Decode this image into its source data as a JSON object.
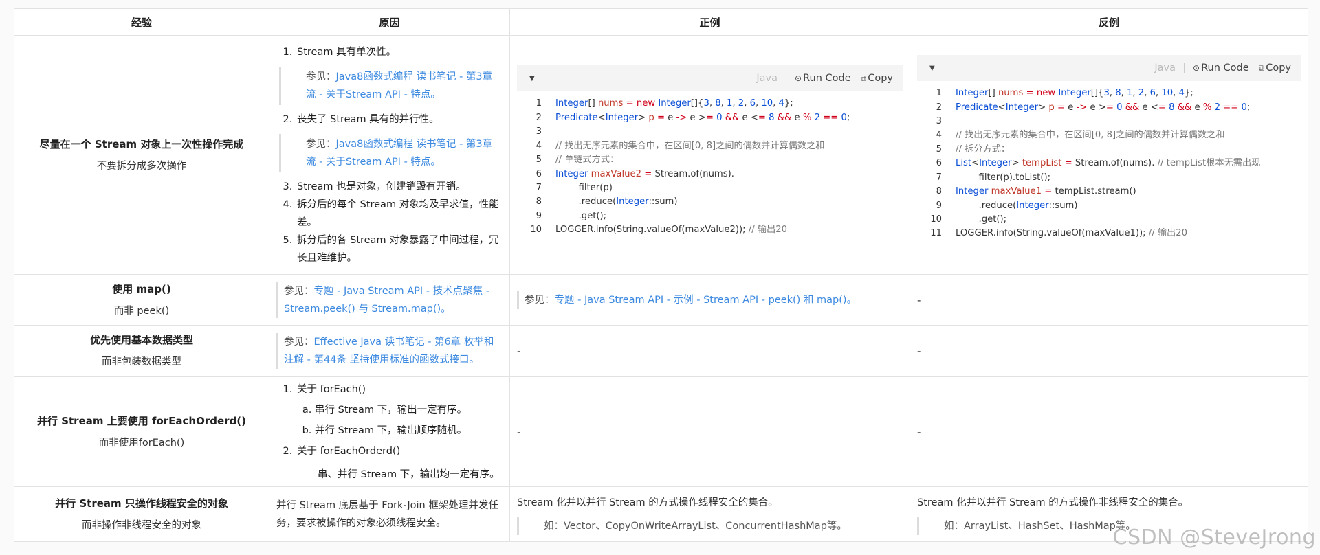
{
  "headers": [
    "经验",
    "原因",
    "正例",
    "反例"
  ],
  "rows": [
    {
      "exp_title": "尽量在一个 Stream 对象上一次性操作完成",
      "exp_sub": "不要拆分成多次操作",
      "reasons": [
        "Stream 具有单次性。",
        "丧失了 Stream 具有的并行性。",
        "Stream 也是对象，创建销毁有开销。",
        "拆分后的每个 Stream 对象均及早求值，性能差。",
        "拆分后的各 Stream 对象暴露了中间过程，冗长且难维护。"
      ],
      "quote_prefix": "参见：",
      "quote_link": "Java8函数式编程 读书笔记 - 第3章 流 - 关于Stream API - 特点。",
      "quote_prefix2": "参见：",
      "quote_link2": "Java8函数式编程 读书笔记 - 第3章 流 - 关于Stream API - 特点。"
    },
    {
      "exp_title": "使用 map()",
      "exp_sub": "而非 peek()",
      "reason_prefix": "参见：",
      "reason_link": "专题 - Java Stream API - 技术点聚焦 - Stream.peek() 与 Stream.map()。",
      "good_prefix": "参见：",
      "good_link": "专题 - Java Stream API - 示例 - Stream API - peek() 和 map()。",
      "bad": "-"
    },
    {
      "exp_title": "优先使用基本数据类型",
      "exp_sub": "而非包装数据类型",
      "reason_prefix": "参见：",
      "reason_link": "Effective Java 读书笔记 - 第6章 枚举和注解 - 第44条 坚持使用标准的函数式接口。",
      "good": "-",
      "bad": "-"
    },
    {
      "exp_title": "并行 Stream 上要使用 forEachOrderd()",
      "exp_sub": "而非使用forEach()",
      "item1": "关于 forEach()",
      "sub_a": "串行 Stream 下，输出一定有序。",
      "sub_b": "并行 Stream 下，输出顺序随机。",
      "item2": "关于 forEachOrderd()",
      "item2_note": "串、并行 Stream 下，输出均一定有序。",
      "good": "-",
      "bad": "-"
    },
    {
      "exp_title": "并行 Stream 只操作线程安全的对象",
      "exp_sub": "而非操作非线程安全的对象",
      "reason": "并行 Stream 底层基于 Fork-Join 框架处理并发任务，要求被操作的对象必须线程安全。",
      "good": "Stream 化并以并行 Stream 的方式操作线程安全的集合。",
      "good_quote": "如：Vector、CopyOnWriteArrayList、ConcurrentHashMap等。",
      "bad": "Stream 化并以并行 Stream 的方式操作非线程安全的集合。",
      "bad_quote": "如：ArrayList、HashSet、HashMap等。"
    }
  ],
  "code_toolbar": {
    "lang": "Java",
    "run": "Run Code",
    "copy": "Copy",
    "run_icon": "play-circle-icon",
    "copy_icon": "copy-icon"
  },
  "good_code": [
    "Integer[] nums = new Integer[]{3, 8, 1, 2, 6, 10, 4};",
    "Predicate<Integer> p = e -> e >= 0 && e <= 8 && e % 2 == 0;",
    "",
    "// 找出无序元素的集合中，在区间[0, 8]之间的偶数并计算偶数之和",
    "// 单链式方式：",
    "Integer maxValue2 = Stream.of(nums).",
    "        filter(p)",
    "        .reduce(Integer::sum)",
    "        .get();",
    "LOGGER.info(String.valueOf(maxValue2)); // 输出20"
  ],
  "bad_code": [
    "Integer[] nums = new Integer[]{3, 8, 1, 2, 6, 10, 4};",
    "Predicate<Integer> p = e -> e >= 0 && e <= 8 && e % 2 == 0;",
    "",
    "// 找出无序元素的集合中，在区间[0, 8]之间的偶数并计算偶数之和",
    "// 拆分方式：",
    "List<Integer> tempList = Stream.of(nums). // tempList根本无需出现",
    "        filter(p).toList();",
    "Integer maxValue1 = tempList.stream()",
    "        .reduce(Integer::sum)",
    "        .get();",
    "LOGGER.info(String.valueOf(maxValue1)); // 输出20"
  ],
  "watermark": "CSDN @SteveJrong"
}
